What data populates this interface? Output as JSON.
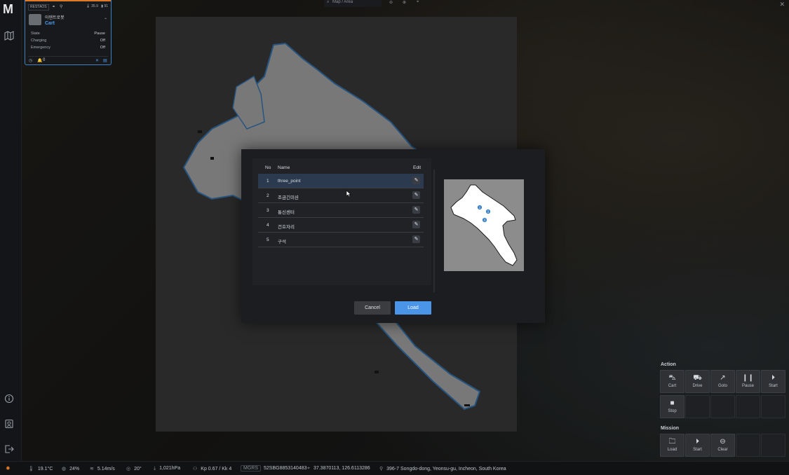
{
  "app": {
    "logo": "M",
    "close": "✕"
  },
  "sidebar": {
    "icons": [
      "map-icon",
      "info-icon",
      "user-icon",
      "logout-icon"
    ]
  },
  "topbar": {
    "search_placeholder": "Map / Area",
    "tools": [
      "zoom-out-icon",
      "zoom-in-icon",
      "locate-icon"
    ]
  },
  "robot_card": {
    "tag": "RESTAOS",
    "temp": "35.9",
    "battery": "91",
    "name": "아덴트로봇",
    "mode": "Cart",
    "rows": [
      {
        "label": "State",
        "value": "Pause"
      },
      {
        "label": "Charging",
        "value": "Off"
      },
      {
        "label": "Emergency",
        "value": "Off"
      }
    ],
    "alerts": "0"
  },
  "dialog": {
    "columns": {
      "no": "No",
      "name": "Name",
      "edit": "Edit"
    },
    "rows": [
      {
        "no": "1",
        "name": "three_point"
      },
      {
        "no": "2",
        "name": "조금긴미션"
      },
      {
        "no": "3",
        "name": "통신센터"
      },
      {
        "no": "4",
        "name": "건호자리"
      },
      {
        "no": "5",
        "name": "구석"
      }
    ],
    "selected_index": 0,
    "cancel_label": "Cancel",
    "load_label": "Load",
    "preview_points": [
      "1",
      "2",
      "3"
    ]
  },
  "action_panel": {
    "title": "Action",
    "buttons": [
      {
        "label": "Cart",
        "icon": "cart-icon",
        "glyph": "🛒"
      },
      {
        "label": "Drive",
        "icon": "car-icon",
        "glyph": "⛟"
      },
      {
        "label": "Goto",
        "icon": "arrow-up-right-icon",
        "glyph": "↗"
      },
      {
        "label": "Pause",
        "icon": "pause-icon",
        "glyph": "❙❙"
      },
      {
        "label": "Start",
        "icon": "play-icon",
        "glyph": "▶"
      },
      {
        "label": "Stop",
        "icon": "stop-icon",
        "glyph": "■"
      }
    ]
  },
  "mission_panel": {
    "title": "Mission",
    "buttons": [
      {
        "label": "Load",
        "icon": "folder-icon",
        "glyph": "▭"
      },
      {
        "label": "Start",
        "icon": "play-icon",
        "glyph": "▶"
      },
      {
        "label": "Clear",
        "icon": "clear-icon",
        "glyph": "⊖"
      }
    ]
  },
  "status_bar": {
    "temperature": "19.1°C",
    "humidity": "24%",
    "wind": "5.14m/s",
    "direction": "20°",
    "pressure": "1,021hPa",
    "kp": "Kp 0.67 / Kk 4",
    "mgrs_label": "MGRS",
    "mgrs": "52SBG8853140483",
    "coords": "37.3870113, 126.6113286",
    "address": "396-7 Songdo-dong, Yeonsu-gu, Incheon, South Korea"
  },
  "colors": {
    "accent": "#4a95e8",
    "selected_row": "#2b3a4f",
    "map_outline": "#3b82c4",
    "top_stripe": "#e07a2b"
  }
}
